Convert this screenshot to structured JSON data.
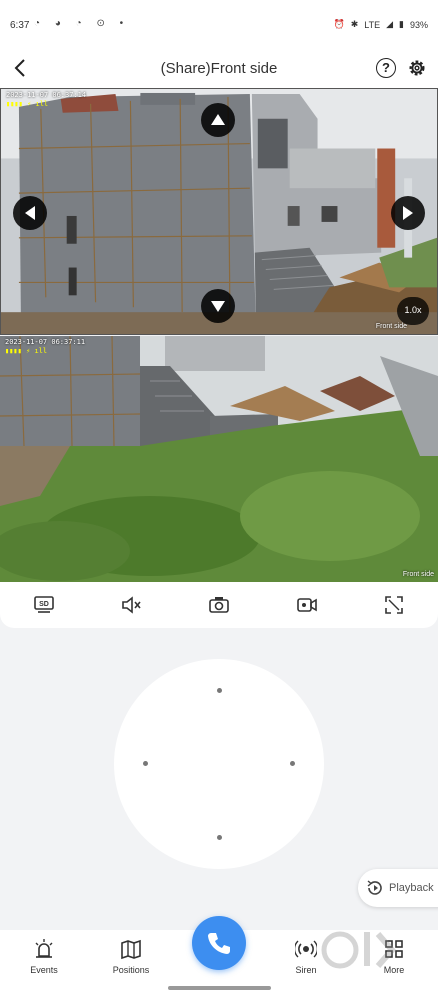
{
  "status_bar": {
    "time": "6:37",
    "battery": "93%",
    "network": "LTE"
  },
  "header": {
    "title": "(Share)Front side"
  },
  "video_main": {
    "osd_timestamp": "2023-11-07 06:37:14",
    "osd_battery": "▮▮▮▮ ⚡ ıll",
    "zoom_label": "1.0x",
    "camera_label": "Front side"
  },
  "video_secondary": {
    "osd_timestamp": "2023-11-07 06:37:11",
    "osd_battery": "▮▮▮▮ ⚡ ıll",
    "camera_label": "Front side"
  },
  "toolbar": {
    "items": [
      {
        "name": "quality",
        "label": "SD",
        "icon": "sd-quality-icon"
      },
      {
        "name": "mute",
        "icon": "speaker-muted-icon"
      },
      {
        "name": "snapshot",
        "icon": "camera-icon"
      },
      {
        "name": "record",
        "icon": "video-record-icon"
      },
      {
        "name": "fullscreen",
        "icon": "expand-icon"
      }
    ]
  },
  "playback": {
    "label": "Playback"
  },
  "bottom_nav": {
    "events": "Events",
    "positions": "Positions",
    "siren": "Siren",
    "more": "More"
  },
  "colors": {
    "accent": "#3d8ef0",
    "background": "#f2f3f5"
  }
}
